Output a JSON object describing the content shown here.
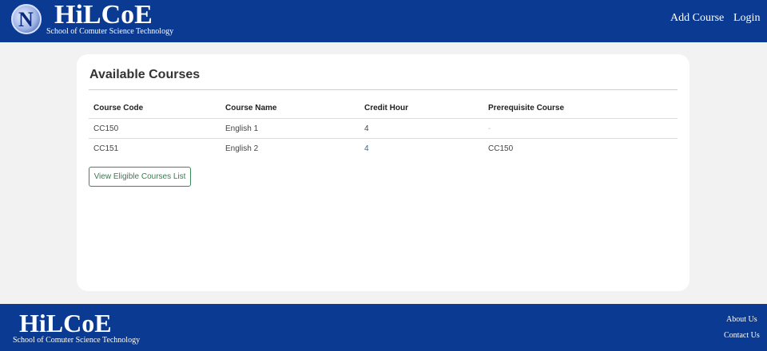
{
  "header": {
    "brand": "HiLCoE",
    "subtitle": "School of Comuter Science Technology",
    "logo_letter": "N",
    "nav": {
      "add_course": "Add Course",
      "login": "Login"
    }
  },
  "main": {
    "title": "Available Courses",
    "table": {
      "headers": [
        "Course Code",
        "Course Name",
        "Credit Hour",
        "Prerequisite Course"
      ],
      "rows": [
        [
          "CC150",
          "English 1",
          "4",
          "-"
        ],
        [
          "CC151",
          "English 2",
          "4",
          "CC150"
        ]
      ]
    },
    "eligible_button": "View Eligible Courses List"
  },
  "footer": {
    "brand": "HiLCoE",
    "subtitle": "School of Comuter Science Technology",
    "links": {
      "about": "About Us",
      "contact": "Contact Us"
    }
  },
  "colors": {
    "header_bg": "#0a3a91",
    "page_bg": "#f2f2f2",
    "button_border": "#3a8a5a"
  }
}
